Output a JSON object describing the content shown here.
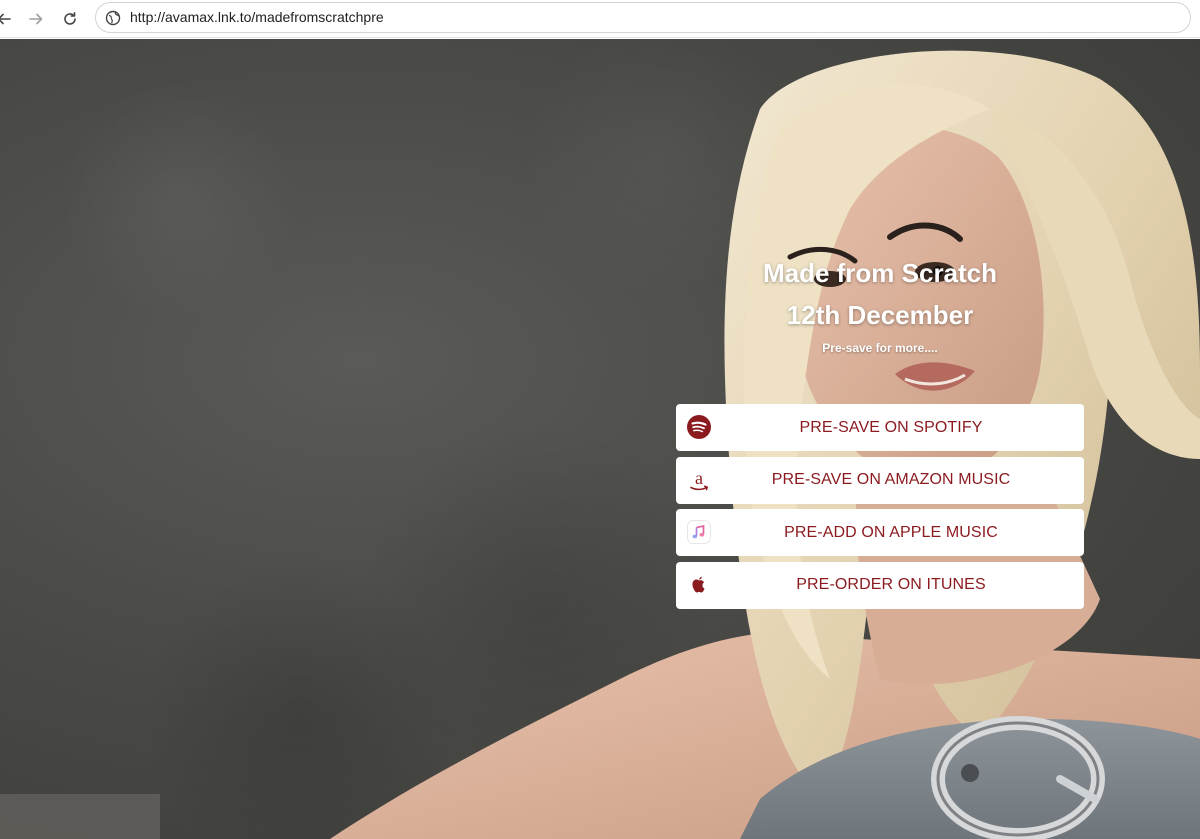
{
  "browser": {
    "url": "http://avamax.lnk.to/madefromscratchpre",
    "back_icon": "arrow-left-icon",
    "forward_icon": "arrow-right-icon",
    "reload_icon": "reload-icon",
    "site_icon": "globe-icon"
  },
  "release": {
    "title": "Made from Scratch",
    "date": "12th December",
    "subtitle": "Pre-save for more...."
  },
  "links": [
    {
      "label": "PRE-SAVE ON SPOTIFY",
      "icon": "spotify-icon"
    },
    {
      "label": "PRE-SAVE ON AMAZON MUSIC",
      "icon": "amazon-icon"
    },
    {
      "label": "PRE-ADD ON APPLE MUSIC",
      "icon": "apple-music-icon"
    },
    {
      "label": "PRE-ORDER ON ITUNES",
      "icon": "apple-icon"
    }
  ],
  "colors": {
    "accent": "#8b1a1f",
    "button_bg": "#ffffff",
    "headline": "#ffffff"
  }
}
